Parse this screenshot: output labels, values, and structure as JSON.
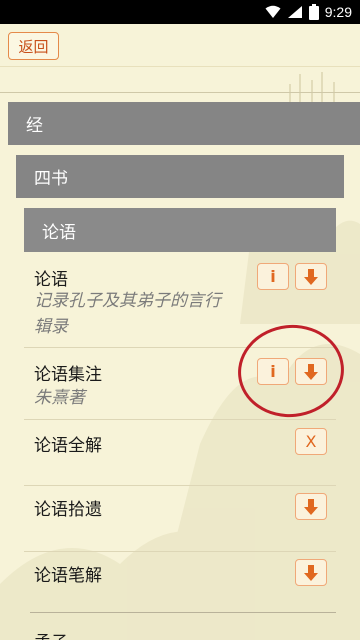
{
  "status_bar": {
    "time": "9:29",
    "icons": [
      "wifi-icon",
      "cell-signal-icon",
      "battery-icon"
    ]
  },
  "topbar": {
    "back_label": "返回"
  },
  "categories": {
    "level1": "经",
    "level2": "四书",
    "level3": "论语"
  },
  "books": [
    {
      "title": "论语",
      "subtitle_line1": "记录孔子及其弟子的言行",
      "subtitle_line2": "辑录",
      "actions": [
        "info",
        "download"
      ]
    },
    {
      "title": "论语集注",
      "subtitle_line1": "朱熹著",
      "actions": [
        "info",
        "download"
      ]
    },
    {
      "title": "论语全解",
      "actions": [
        "delete"
      ]
    },
    {
      "title": "论语拾遗",
      "actions": [
        "download"
      ]
    },
    {
      "title": "论语笔解",
      "actions": [
        "download"
      ]
    }
  ],
  "labels": {
    "info": "i",
    "delete": "X"
  },
  "next_partial": "孟子",
  "colors": {
    "accent": "#e06820",
    "band": "#858585",
    "background": "#f7f3d8",
    "highlight_circle": "#c0202a"
  }
}
